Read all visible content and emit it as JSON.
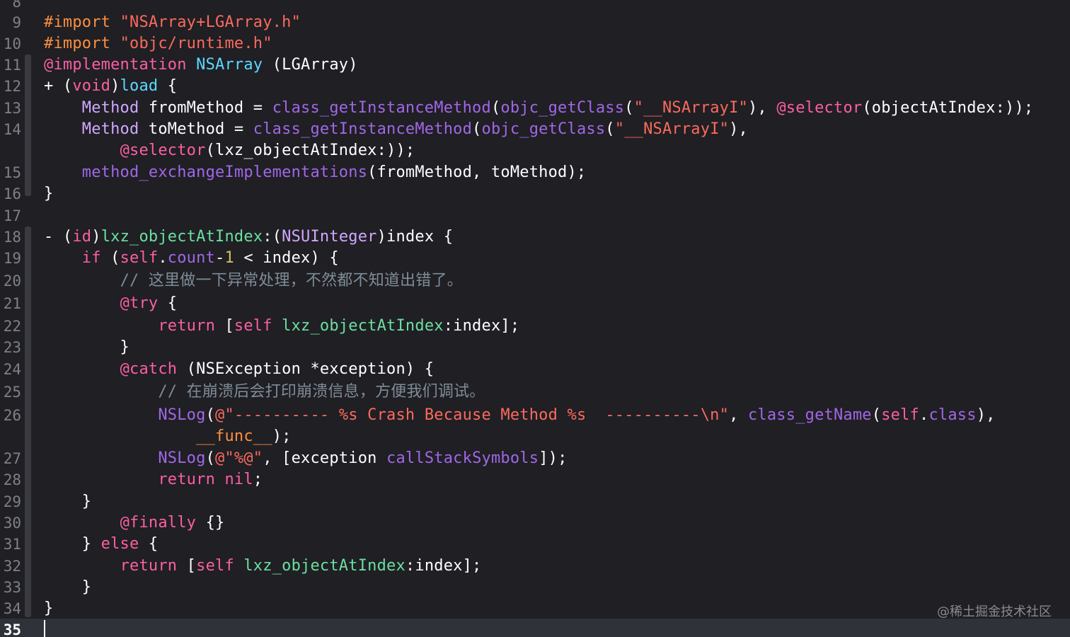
{
  "gutter": {
    "line_numbers": [
      "8",
      "9",
      "10",
      "11",
      "12",
      "13",
      "14",
      "15",
      "16",
      "17",
      "18",
      "19",
      "20",
      "21",
      "22",
      "23",
      "24",
      "25",
      "26",
      "27",
      "28",
      "29",
      "30",
      "31",
      "32",
      "33",
      "34",
      "35"
    ],
    "current_line": "35"
  },
  "code": {
    "lines": [
      [
        [
          "t-pre",
          "#import "
        ],
        [
          "t-str",
          "\"NSArray+LGArray.h\""
        ]
      ],
      [
        [
          "t-pre",
          "#import "
        ],
        [
          "t-str",
          "\"objc/runtime.h\""
        ]
      ],
      [
        [
          "t-kw",
          "@implementation "
        ],
        [
          "t-type",
          "NSArray"
        ],
        [
          "t-plain",
          " (LGArray)"
        ]
      ],
      [
        [
          "t-plain",
          "+ ("
        ],
        [
          "t-kw",
          "void"
        ],
        [
          "t-plain",
          ")"
        ],
        [
          "t-type",
          "load"
        ],
        [
          "t-plain",
          " {"
        ]
      ],
      [
        [
          "t-plain",
          "    "
        ],
        [
          "t-typeL",
          "Method"
        ],
        [
          "t-plain",
          " fromMethod = "
        ],
        [
          "t-fn",
          "class_getInstanceMethod"
        ],
        [
          "t-plain",
          "("
        ],
        [
          "t-fn",
          "objc_getClass"
        ],
        [
          "t-plain",
          "("
        ],
        [
          "t-str",
          "\"__NSArrayI\""
        ],
        [
          "t-plain",
          "), "
        ],
        [
          "t-kw",
          "@selector"
        ],
        [
          "t-plain",
          "(objectAtIndex:));"
        ]
      ],
      [
        [
          "t-plain",
          "    "
        ],
        [
          "t-typeL",
          "Method"
        ],
        [
          "t-plain",
          " toMethod = "
        ],
        [
          "t-fn",
          "class_getInstanceMethod"
        ],
        [
          "t-plain",
          "("
        ],
        [
          "t-fn",
          "objc_getClass"
        ],
        [
          "t-plain",
          "("
        ],
        [
          "t-str",
          "\"__NSArrayI\""
        ],
        [
          "t-plain",
          "),"
        ]
      ],
      [
        [
          "t-plain",
          "        "
        ],
        [
          "t-kw",
          "@selector"
        ],
        [
          "t-plain",
          "(lxz_objectAtIndex:));"
        ]
      ],
      [
        [
          "t-plain",
          "    "
        ],
        [
          "t-fn",
          "method_exchangeImplementations"
        ],
        [
          "t-plain",
          "(fromMethod, toMethod);"
        ]
      ],
      [
        [
          "t-plain",
          "}"
        ]
      ],
      [
        [
          "t-plain",
          ""
        ]
      ],
      [
        [
          "t-plain",
          "- ("
        ],
        [
          "t-kw",
          "id"
        ],
        [
          "t-plain",
          ")"
        ],
        [
          "t-green",
          "lxz_objectAtIndex"
        ],
        [
          "t-plain",
          ":("
        ],
        [
          "t-typeL",
          "NSUInteger"
        ],
        [
          "t-plain",
          ")index {"
        ]
      ],
      [
        [
          "t-plain",
          "    "
        ],
        [
          "t-kw",
          "if"
        ],
        [
          "t-plain",
          " ("
        ],
        [
          "t-kw",
          "self"
        ],
        [
          "t-plain",
          "."
        ],
        [
          "t-fn",
          "count"
        ],
        [
          "t-plain",
          "-"
        ],
        [
          "t-num",
          "1"
        ],
        [
          "t-plain",
          " < index) {"
        ]
      ],
      [
        [
          "t-plain",
          "        "
        ],
        [
          "t-com",
          "// 这里做一下异常处理，不然都不知道出错了。"
        ]
      ],
      [
        [
          "t-plain",
          "        "
        ],
        [
          "t-kw",
          "@try"
        ],
        [
          "t-plain",
          " {"
        ]
      ],
      [
        [
          "t-plain",
          "            "
        ],
        [
          "t-kw",
          "return"
        ],
        [
          "t-plain",
          " ["
        ],
        [
          "t-kw",
          "self"
        ],
        [
          "t-plain",
          " "
        ],
        [
          "t-green",
          "lxz_objectAtIndex"
        ],
        [
          "t-plain",
          ":index];"
        ]
      ],
      [
        [
          "t-plain",
          "        }"
        ]
      ],
      [
        [
          "t-plain",
          "        "
        ],
        [
          "t-kw",
          "@catch"
        ],
        [
          "t-plain",
          " (NSException *exception) {"
        ]
      ],
      [
        [
          "t-plain",
          "            "
        ],
        [
          "t-com",
          "// 在崩溃后会打印崩溃信息，方便我们调试。"
        ]
      ],
      [
        [
          "t-plain",
          "            "
        ],
        [
          "t-fn",
          "NSLog"
        ],
        [
          "t-plain",
          "("
        ],
        [
          "t-str",
          "@\"---------- %s Crash Because Method %s  ----------\\n\""
        ],
        [
          "t-plain",
          ", "
        ],
        [
          "t-fn",
          "class_getName"
        ],
        [
          "t-plain",
          "("
        ],
        [
          "t-kw",
          "self"
        ],
        [
          "t-plain",
          "."
        ],
        [
          "t-fn",
          "class"
        ],
        [
          "t-plain",
          "),"
        ]
      ],
      [
        [
          "t-plain",
          "                "
        ],
        [
          "t-pre",
          "__func__"
        ],
        [
          "t-plain",
          ");"
        ]
      ],
      [
        [
          "t-plain",
          "            "
        ],
        [
          "t-fn",
          "NSLog"
        ],
        [
          "t-plain",
          "("
        ],
        [
          "t-str",
          "@\"%@\""
        ],
        [
          "t-plain",
          ", [exception "
        ],
        [
          "t-fn",
          "callStackSymbols"
        ],
        [
          "t-plain",
          "]);"
        ]
      ],
      [
        [
          "t-plain",
          "            "
        ],
        [
          "t-kw",
          "return nil"
        ],
        [
          "t-plain",
          ";"
        ]
      ],
      [
        [
          "t-plain",
          "    }"
        ]
      ],
      [
        [
          "t-plain",
          "        "
        ],
        [
          "t-kw",
          "@finally"
        ],
        [
          "t-plain",
          " {}"
        ]
      ],
      [
        [
          "t-plain",
          "    } "
        ],
        [
          "t-kw",
          "else"
        ],
        [
          "t-plain",
          " {"
        ]
      ],
      [
        [
          "t-plain",
          "        "
        ],
        [
          "t-kw",
          "return"
        ],
        [
          "t-plain",
          " ["
        ],
        [
          "t-kw",
          "self"
        ],
        [
          "t-plain",
          " "
        ],
        [
          "t-green",
          "lxz_objectAtIndex"
        ],
        [
          "t-plain",
          ":index];"
        ]
      ],
      [
        [
          "t-plain",
          "    }"
        ]
      ],
      [
        [
          "t-plain",
          "}"
        ]
      ],
      [
        [
          "t-plain",
          ""
        ]
      ]
    ]
  },
  "watermark": "@稀土掘金技术社区"
}
